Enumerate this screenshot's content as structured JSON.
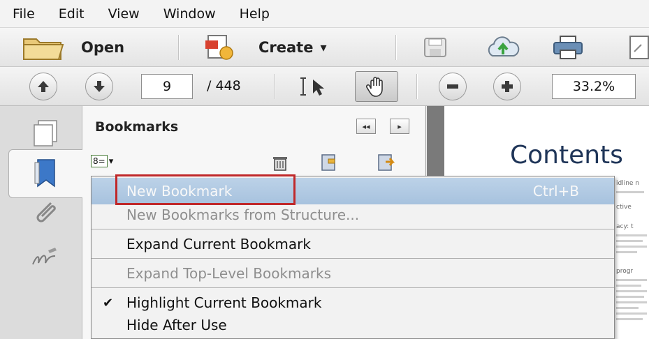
{
  "menubar": {
    "items": [
      "File",
      "Edit",
      "View",
      "Window",
      "Help"
    ]
  },
  "toolbar": {
    "open_label": "Open",
    "create_label": "Create",
    "create_arrow": "▾"
  },
  "nav": {
    "page_current": "9",
    "page_total": "/ 448",
    "zoom": "33.2%"
  },
  "panel": {
    "title": "Bookmarks",
    "collapse_glyph": "◂◂",
    "expand_glyph": "▸",
    "options_glyph": "8=",
    "options_arrow": "▾"
  },
  "menu": {
    "items": [
      {
        "label": "New Bookmark",
        "shortcut": "Ctrl+B",
        "state": "highlighted"
      },
      {
        "label": "New Bookmarks from Structure...",
        "state": "disabled"
      },
      {
        "label": "Expand Current Bookmark",
        "state": "enabled"
      },
      {
        "label": "Expand Top-Level Bookmarks",
        "state": "disabled"
      },
      {
        "label": "Highlight Current Bookmark",
        "state": "checked"
      },
      {
        "label": "Hide After Use",
        "state": "enabled"
      }
    ],
    "check_glyph": "✔"
  },
  "document": {
    "title": "Contents",
    "snippets": [
      "idline n",
      "ctive",
      "acy: t",
      "progr"
    ]
  },
  "colors": {
    "highlight": "#a7c2de",
    "annotation": "#c0282a",
    "doc_title": "#1f3558"
  }
}
